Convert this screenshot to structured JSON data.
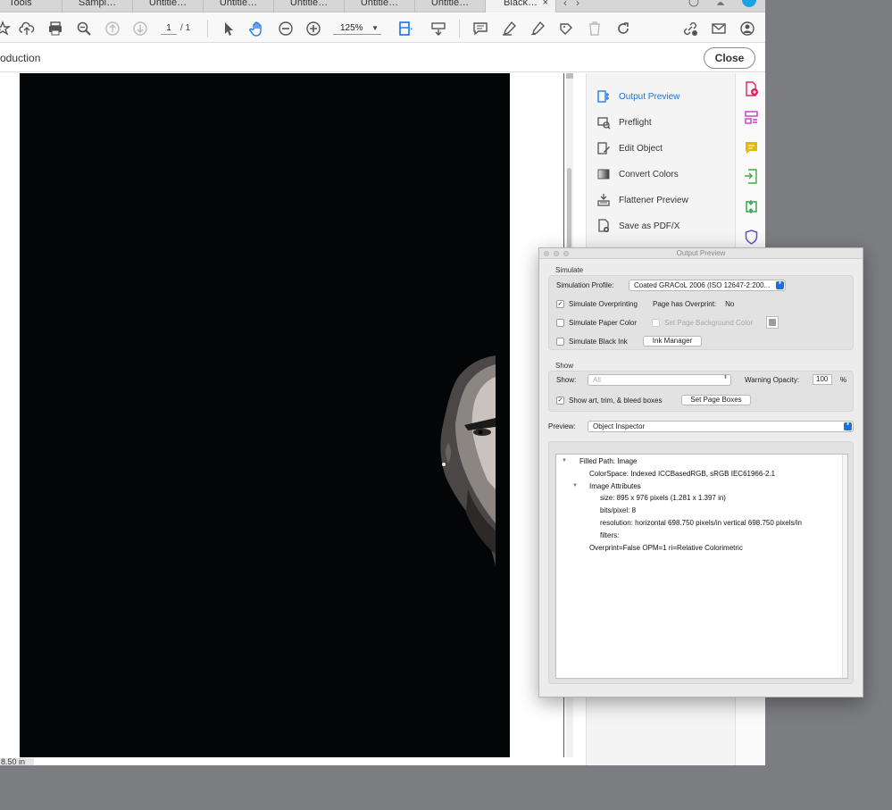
{
  "tabs": {
    "tools": "Tools",
    "items": [
      "Sampl…",
      "Untitle…",
      "Untitle…",
      "Untitle…",
      "Untitle…",
      "Untitle…",
      "Black…"
    ],
    "active": "Black…",
    "close_glyph": "×",
    "nav_prev": "‹",
    "nav_next": "›"
  },
  "toolbar": {
    "page_current": "1",
    "page_total": "/ 1",
    "zoom": "125%",
    "zoom_caret": "▼",
    "icons": [
      "star-icon",
      "cloud-upload-icon",
      "print-icon",
      "zoom-out-magnifier-icon",
      "page-up-icon",
      "page-down-icon",
      "select-arrow-icon",
      "hand-icon",
      "zoom-out-icon",
      "zoom-in-icon",
      "fit-page-icon",
      "keyboard-icon",
      "comment-icon",
      "highlight-icon",
      "sign-icon",
      "stamp-icon",
      "delete-icon",
      "rotate-icon",
      "link-icon",
      "mail-icon",
      "account-icon"
    ]
  },
  "secondary": {
    "title": "oduction",
    "close_label": "Close"
  },
  "document": {
    "size_label": "8.50 in",
    "page_color": "#040507"
  },
  "tools_panel": [
    {
      "label": "Output Preview",
      "icon": "output-preview-icon",
      "active": true
    },
    {
      "label": "Preflight",
      "icon": "preflight-icon",
      "active": false
    },
    {
      "label": "Edit Object",
      "icon": "edit-object-icon",
      "active": false
    },
    {
      "label": "Convert Colors",
      "icon": "convert-colors-icon",
      "active": false
    },
    {
      "label": "Flattener Preview",
      "icon": "flattener-preview-icon",
      "active": false
    },
    {
      "label": "Save as PDF/X",
      "icon": "save-as-pdfx-icon",
      "active": false
    }
  ],
  "rail": [
    {
      "icon": "add-pdf-icon",
      "color": "#e0245e"
    },
    {
      "icon": "organize-pages-icon",
      "color": "#c83bc8"
    },
    {
      "icon": "comment-icon",
      "color": "#e6b800"
    },
    {
      "icon": "export-pdf-icon",
      "color": "#3fae3f"
    },
    {
      "icon": "compress-icon",
      "color": "#2e9d4a"
    },
    {
      "icon": "protect-icon",
      "color": "#5a4fd6"
    }
  ],
  "dialog": {
    "title": "Output Preview",
    "simulate_label": "Simulate",
    "simulation_profile_label": "Simulation Profile:",
    "simulation_profile_value": "Coated GRACoL 2006 (ISO 12647-2:200...",
    "simulate_overprinting": "Simulate Overprinting",
    "page_has_overprint_label": "Page has Overprint:",
    "page_has_overprint_value": "No",
    "simulate_paper_color": "Simulate Paper Color",
    "set_page_bg_color": "Set Page Background Color",
    "simulate_black_ink": "Simulate Black Ink",
    "ink_manager": "Ink Manager",
    "show_group_label": "Show",
    "show_label": "Show:",
    "show_value": "All",
    "warning_opacity_label": "Warning Opacity:",
    "warning_opacity_value": "100",
    "percent": "%",
    "show_boxes": "Show art, trim, & bleed boxes",
    "set_page_boxes": "Set Page Boxes",
    "preview_label": "Preview:",
    "preview_value": "Object Inspector",
    "checkmark": "✓",
    "stepper_glyph": "⬍",
    "tree_collapse_glyph": "▼",
    "accent": "#1d6fe0"
  },
  "inspector": {
    "root": "Filled Path: Image",
    "colorspace": "ColorSpace: Indexed ICCBasedRGB, sRGB IEC61966-2.1",
    "image_attributes": "Image Attributes",
    "size": "size: 895 x 976 pixels (1.281 x 1.397 in)",
    "bits": "bits/pixel: 8",
    "resolution": "resolution: horizontal 698.750 pixels/in vertical 698.750 pixels/in",
    "filters": "filters:",
    "overprint": "Overprint=False OPM=1 ri=Relative Colorimetric"
  }
}
